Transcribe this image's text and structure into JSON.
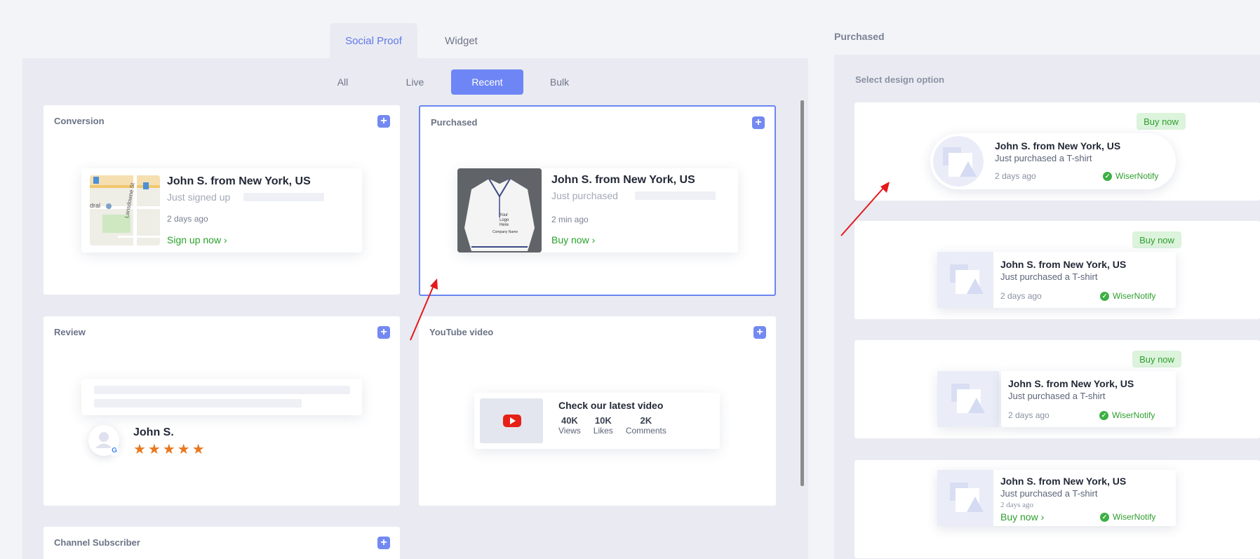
{
  "top_tabs": [
    "Social Proof",
    "Widget"
  ],
  "sub_tabs": [
    "All",
    "Live",
    "Recent",
    "Bulk"
  ],
  "cards": {
    "conversion": {
      "title": "Conversion",
      "name": "John S. from New York, US",
      "action": "Just signed up",
      "time": "2 days ago",
      "cta": "Sign up now",
      "map_labels": [
        "dral",
        "Lansdowne St"
      ]
    },
    "purchased": {
      "title": "Purchased",
      "name": "John S. from New York, US",
      "action": "Just purchased",
      "time": "2 min ago",
      "cta": "Buy now",
      "shirt_text": "Your Logo Here",
      "shirt_company": "Company Name"
    },
    "review": {
      "title": "Review",
      "name": "John S.",
      "stars": "★★★★★"
    },
    "youtube": {
      "title": "YouTube video",
      "heading": "Check our latest video",
      "stats": [
        {
          "value": "40K",
          "label": "Views"
        },
        {
          "value": "10K",
          "label": "Likes"
        },
        {
          "value": "2K",
          "label": "Comments"
        }
      ]
    },
    "channel": {
      "title": "Channel Subscriber"
    }
  },
  "right_panel": {
    "title": "Purchased",
    "subtitle": "Select design option",
    "designs": [
      {
        "pill": "Buy now",
        "name": "John S. from New York, US",
        "sub": "Just purchased a T-shirt",
        "time": "2 days ago",
        "brand": "WiserNotify"
      },
      {
        "pill": "Buy now",
        "name": "John S. from New York, US",
        "sub": "Just purchased a T-shirt",
        "time": "2 days ago",
        "brand": "WiserNotify"
      },
      {
        "pill": "Buy now",
        "name": "John S. from New York, US",
        "sub": "Just purchased a T-shirt",
        "time": "2 days ago",
        "brand": "WiserNotify"
      },
      {
        "name": "John S. from New York, US",
        "sub": "Just purchased a T-shirt",
        "time": "2 days ago",
        "cta": "Buy now",
        "brand": "WiserNotify"
      }
    ]
  },
  "colors": {
    "accent": "#6e86f5",
    "success": "#2e9e2e",
    "arrow": "#e3191c",
    "youtube": "#e62117",
    "star": "#e8781e"
  }
}
